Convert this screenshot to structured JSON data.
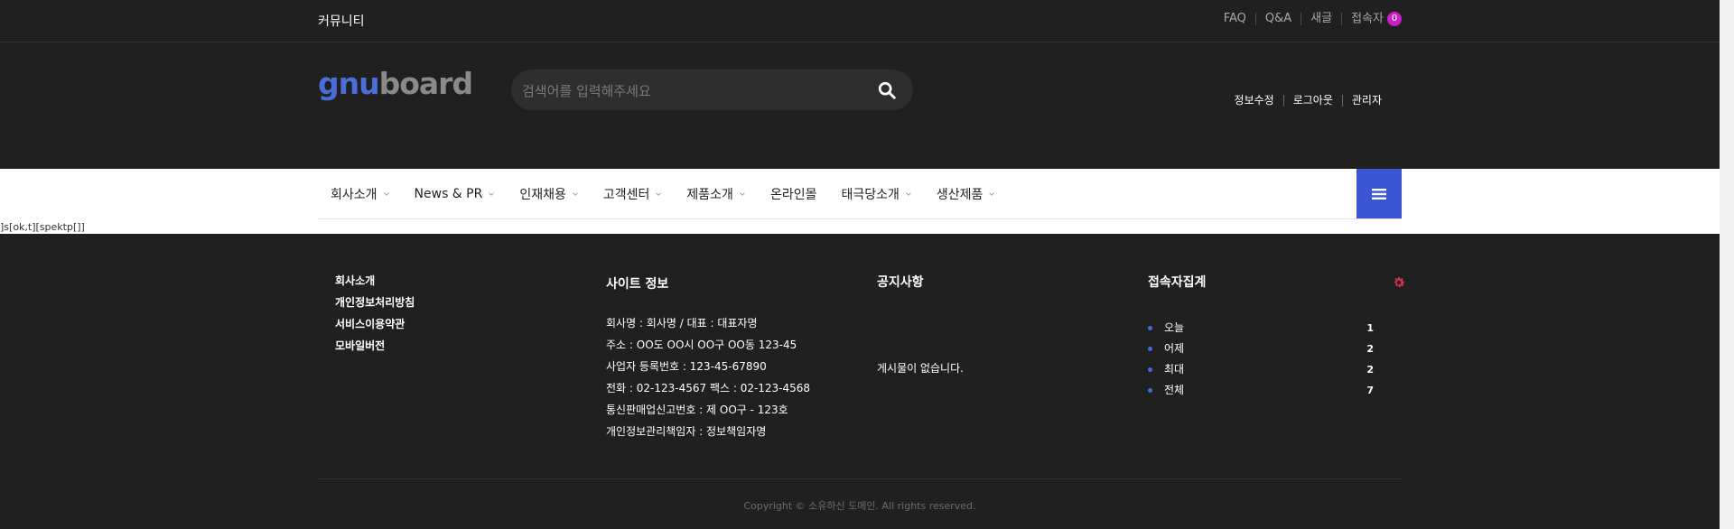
{
  "topbar": {
    "community": "커뮤니티",
    "links": [
      "FAQ",
      "Q&A",
      "새글",
      "접속자"
    ],
    "visitor_badge": "0"
  },
  "header": {
    "logo_gnu": "gnu",
    "logo_board": "board",
    "search_placeholder": "검색어를 입력해주세요",
    "user_menu": [
      "정보수정",
      "로그아웃",
      "관리자"
    ]
  },
  "nav": {
    "items": [
      {
        "label": "회사소개",
        "has_submenu": true
      },
      {
        "label": "News & PR",
        "has_submenu": true
      },
      {
        "label": "인재채용",
        "has_submenu": true
      },
      {
        "label": "고객센터",
        "has_submenu": true
      },
      {
        "label": "제품소개",
        "has_submenu": true
      },
      {
        "label": "온라인몰",
        "has_submenu": false
      },
      {
        "label": "태극당소개",
        "has_submenu": true
      },
      {
        "label": "생산제품",
        "has_submenu": true
      }
    ],
    "stray_text": "]s[ok,t][spektp[]]"
  },
  "footer": {
    "links": [
      "회사소개",
      "개인정보처리방침",
      "서비스이용약관",
      "모바일버전"
    ],
    "site_info_title": "사이트 정보",
    "site_info": [
      "회사명 : 회사명 / 대표 : 대표자명",
      "주소 : OO도 OO시 OO구 OO동 123-45",
      "사업자 등록번호 : 123-45-67890",
      "전화 : 02-123-4567 팩스 : 02-123-4568",
      "통신판매업신고번호 : 제 OO구 - 123호",
      "개인정보관리책임자 : 정보책임자명"
    ],
    "notice_title": "공지사항",
    "notice_empty": "게시물이 없습니다.",
    "visit_title": "접속자집계",
    "visits": [
      {
        "label": "오늘",
        "value": "1"
      },
      {
        "label": "어제",
        "value": "2"
      },
      {
        "label": "최대",
        "value": "2"
      },
      {
        "label": "전체",
        "value": "7"
      }
    ],
    "copyright": "Copyright © 소유하신 도메인. All rights reserved."
  },
  "colors": {
    "accent": "#3b55d3",
    "badge": "#c91fc7",
    "gear": "#d9344a",
    "dark_bg": "#202020"
  }
}
